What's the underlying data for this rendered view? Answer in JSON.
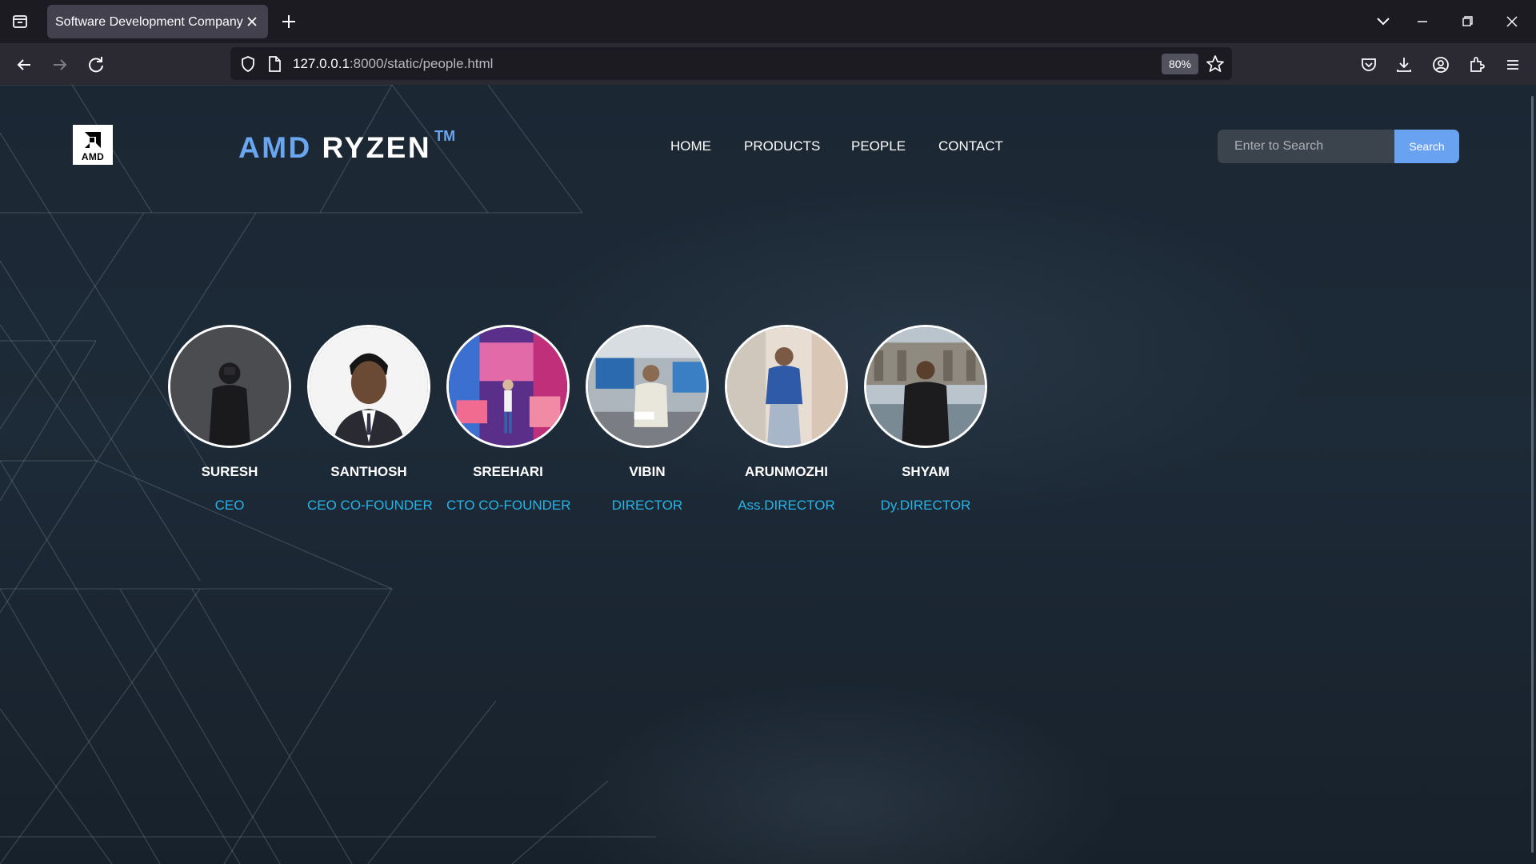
{
  "browser": {
    "tab_title": "Software Development Company",
    "url_host": "127.0.0.1",
    "url_rest": ":8000/static/people.html",
    "zoom": "80%"
  },
  "site": {
    "logo_text": "AMD",
    "brand_part1": "AMD",
    "brand_part2": "RYZEN",
    "brand_tm": "TM",
    "nav": [
      "HOME",
      "PRODUCTS",
      "PEOPLE",
      "CONTACT"
    ],
    "search_placeholder": "Enter to Search",
    "search_button": "Search"
  },
  "people": [
    {
      "name": "SURESH",
      "role": "CEO"
    },
    {
      "name": "SANTHOSH",
      "role": "CEO CO-FOUNDER"
    },
    {
      "name": "SREEHARI",
      "role": "CTO CO-FOUNDER"
    },
    {
      "name": "VIBIN",
      "role": "DIRECTOR"
    },
    {
      "name": "ARUNMOZHI",
      "role": "Ass.DIRECTOR"
    },
    {
      "name": "SHYAM",
      "role": "Dy.DIRECTOR"
    }
  ],
  "colors": {
    "accent_blue": "#6aa5f0",
    "role_cyan": "#27b3e6",
    "background": "#1d2a37"
  }
}
